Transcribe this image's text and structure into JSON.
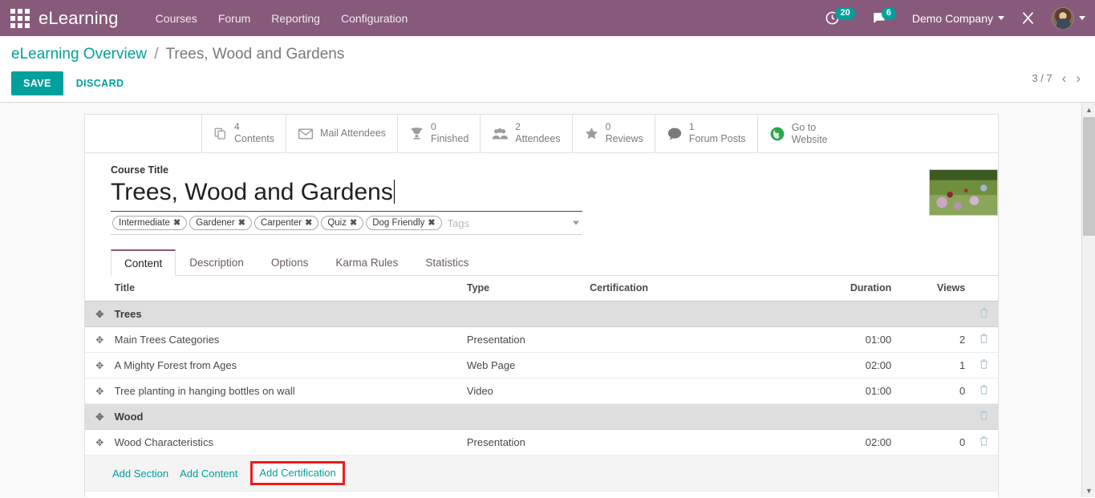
{
  "navbar": {
    "apps_icon": "apps-grid-icon",
    "brand": "eLearning",
    "menu": [
      {
        "label": "Courses"
      },
      {
        "label": "Forum"
      },
      {
        "label": "Reporting"
      },
      {
        "label": "Configuration"
      }
    ],
    "activities": {
      "icon": "clock-activity-icon",
      "badge": "20"
    },
    "messages": {
      "icon": "chat-bubble-icon",
      "badge": "6"
    },
    "company": "Demo Company",
    "debug_icon": "wrench-tools-icon",
    "avatar_icon": "user-avatar"
  },
  "control_panel": {
    "breadcrumb_root": "eLearning Overview",
    "breadcrumb_sep": "/",
    "breadcrumb_current": "Trees, Wood and Gardens",
    "save_label": "SAVE",
    "discard_label": "DISCARD",
    "pager_count": "3 / 7",
    "pager_prev": "‹",
    "pager_next": "›"
  },
  "stat_buttons": [
    {
      "value": "4",
      "label": "Contents",
      "icon": "duplicate-files-icon"
    },
    {
      "value": "",
      "label": "Mail Attendees",
      "icon": "envelope-icon"
    },
    {
      "value": "0",
      "label": "Finished",
      "icon": "trophy-icon"
    },
    {
      "value": "2",
      "label": "Attendees",
      "icon": "users-group-icon"
    },
    {
      "value": "0",
      "label": "Reviews",
      "icon": "star-icon"
    },
    {
      "value": "1",
      "label": "Forum Posts",
      "icon": "comment-bubble-icon"
    },
    {
      "value": "",
      "label": "Go to\nWebsite",
      "label_line1": "Go to",
      "label_line2": "Website",
      "icon": "globe-icon"
    }
  ],
  "form": {
    "title_field_label": "Course Title",
    "title_value": "Trees, Wood and Gardens",
    "tags_placeholder": "Tags",
    "tags": [
      {
        "label": "Intermediate",
        "remove": "✖"
      },
      {
        "label": "Gardener",
        "remove": "✖"
      },
      {
        "label": "Carpenter",
        "remove": "✖"
      },
      {
        "label": "Quiz",
        "remove": "✖"
      },
      {
        "label": "Dog Friendly",
        "remove": "✖"
      }
    ],
    "image_alt": "course-cover-garden-flowers"
  },
  "tabs": [
    {
      "label": "Content",
      "active": true
    },
    {
      "label": "Description",
      "active": false
    },
    {
      "label": "Options",
      "active": false
    },
    {
      "label": "Karma Rules",
      "active": false
    },
    {
      "label": "Statistics",
      "active": false
    }
  ],
  "content_table": {
    "headers": {
      "title": "Title",
      "type": "Type",
      "certification": "Certification",
      "duration": "Duration",
      "views": "Views"
    },
    "rows": [
      {
        "kind": "section",
        "title": "Trees",
        "type": "",
        "certification": "",
        "duration": "",
        "views": ""
      },
      {
        "kind": "data",
        "title": "Main Trees Categories",
        "type": "Presentation",
        "certification": "",
        "duration": "01:00",
        "views": "2"
      },
      {
        "kind": "data",
        "title": "A Mighty Forest from Ages",
        "type": "Web Page",
        "certification": "",
        "duration": "02:00",
        "views": "1"
      },
      {
        "kind": "data",
        "title": "Tree planting in hanging bottles on wall",
        "type": "Video",
        "certification": "",
        "duration": "01:00",
        "views": "0"
      },
      {
        "kind": "section",
        "title": "Wood",
        "type": "",
        "certification": "",
        "duration": "",
        "views": ""
      },
      {
        "kind": "data",
        "title": "Wood Characteristics",
        "type": "Presentation",
        "certification": "",
        "duration": "02:00",
        "views": "0"
      }
    ],
    "add_links": [
      {
        "label": "Add Section",
        "highlighted": false
      },
      {
        "label": "Add Content",
        "highlighted": false
      },
      {
        "label": "Add Certification",
        "highlighted": true
      }
    ]
  },
  "colors": {
    "brand_purple": "#875A7B",
    "accent_teal": "#00A09D",
    "highlight_red": "#EF1C1C",
    "section_gray": "#DEDEDF"
  }
}
